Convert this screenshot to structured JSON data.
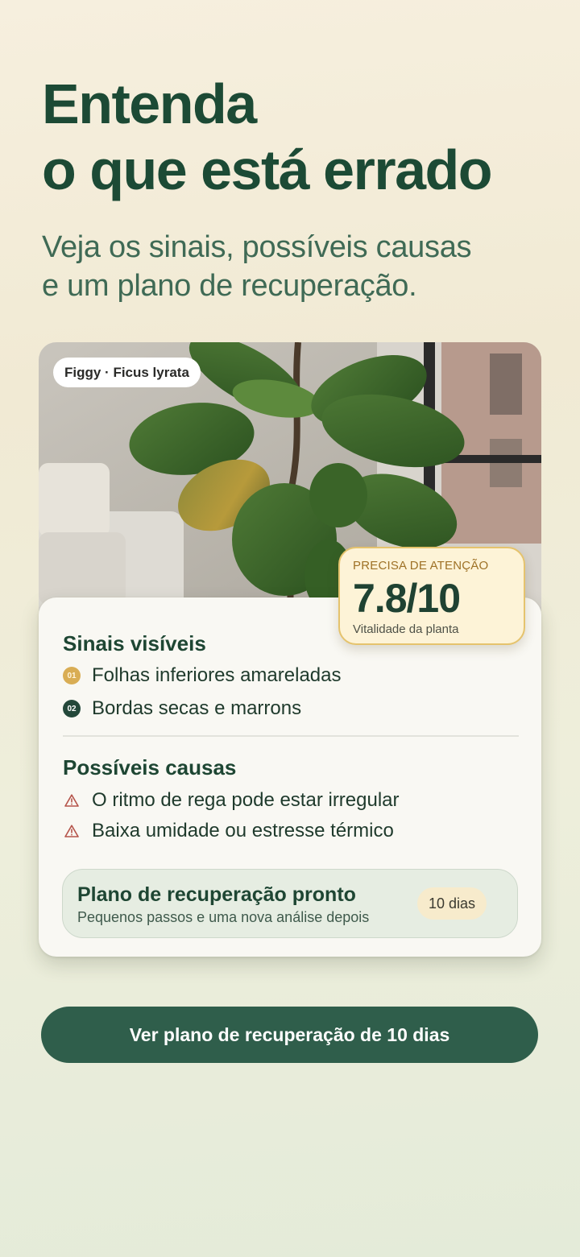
{
  "headline": {
    "line1": "Entenda",
    "line2": "o que está errado"
  },
  "subtitle": {
    "line1": "Veja os sinais, possíveis causas",
    "line2": "e um plano de recuperação."
  },
  "plant": {
    "name_label": "Figgy · Ficus lyrata"
  },
  "score": {
    "status": "PRECISA DE ATENÇÃO",
    "value": "7.8/10",
    "caption": "Vitalidade da planta",
    "level": 0.78
  },
  "signs": {
    "title": "Sinais visíveis",
    "items": [
      {
        "num": "01",
        "text": "Folhas inferiores amareladas"
      },
      {
        "num": "02",
        "text": "Bordas secas e marrons"
      }
    ]
  },
  "causes": {
    "title": "Possíveis causas",
    "items": [
      {
        "icon": "warning-icon",
        "text": "O ritmo de rega pode estar irregular"
      },
      {
        "icon": "warning-icon",
        "text": "Baixa umidade ou estresse térmico"
      }
    ]
  },
  "plan": {
    "title": "Plano de recuperação pronto",
    "subtitle": "Pequenos passos e uma nova análise depois",
    "badge": "10 dias"
  },
  "cta": {
    "label": "Ver plano de recuperação de 10 dias"
  },
  "colors": {
    "primary": "#2f5e4b",
    "heading": "#1c4a35",
    "accent_amber": "#e5c36d",
    "warning": "#b5544a"
  }
}
